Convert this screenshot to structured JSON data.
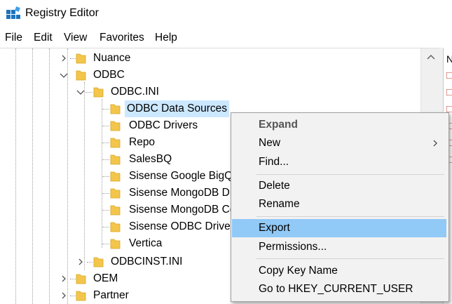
{
  "window": {
    "title": "Registry Editor"
  },
  "menu": [
    "File",
    "Edit",
    "View",
    "Favorites",
    "Help"
  ],
  "tree": {
    "nuance": "Nuance",
    "odbc": "ODBC",
    "odbc_ini": "ODBC.INI",
    "children": [
      "ODBC Data Sources",
      "ODBC Drivers",
      "Repo",
      "SalesBQ",
      "Sisense Google BigQuery",
      "Sisense MongoDB Driver",
      "Sisense MongoDB Connector",
      "Sisense ODBC Driver",
      "Vertica"
    ],
    "odbcinst_ini": "ODBCINST.INI",
    "oem": "OEM",
    "partner": "Partner",
    "selected": "ODBC Data Sources"
  },
  "right_pane": {
    "header_char": "N"
  },
  "context_menu": {
    "expand": "Expand",
    "new": "New",
    "find": "Find...",
    "delete": "Delete",
    "rename": "Rename",
    "export": "Export",
    "permissions": "Permissions...",
    "copy_key_name": "Copy Key Name",
    "goto": "Go to HKEY_CURRENT_USER"
  },
  "colors": {
    "selection": "#cce8ff",
    "menu_highlight": "#91c9f7",
    "folder": "#f3c64b"
  }
}
